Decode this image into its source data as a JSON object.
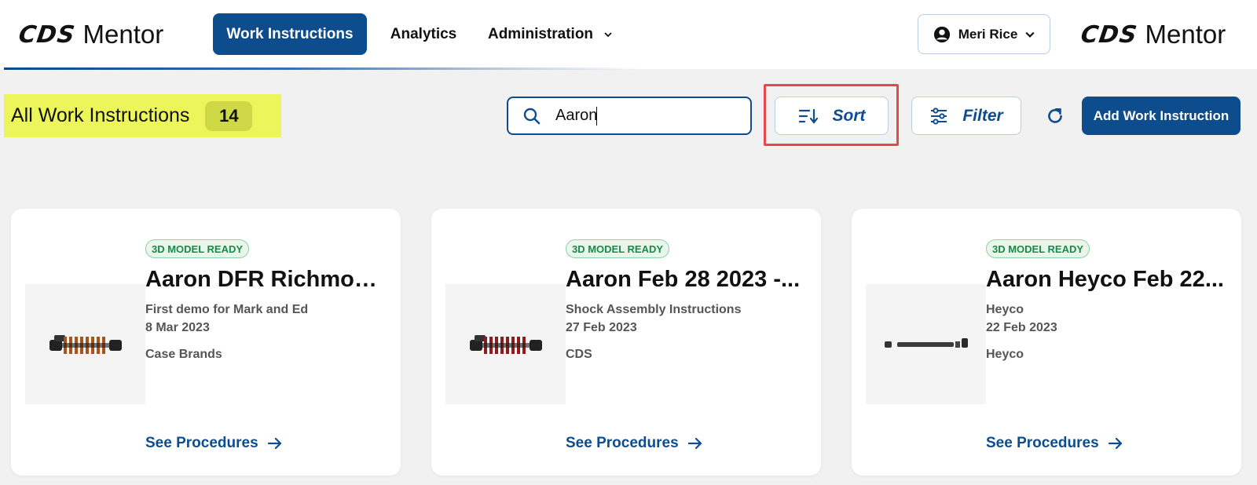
{
  "header": {
    "logo": {
      "mark": "CDS",
      "word": "Mentor"
    },
    "nav": {
      "work_instructions": "Work Instructions",
      "analytics": "Analytics",
      "administration": "Administration"
    },
    "user": {
      "name": "Meri Rice",
      "icon": "account-circle-icon"
    },
    "brand_logo": {
      "mark": "CDS",
      "word": "Mentor"
    }
  },
  "toolbar": {
    "title": "All Work Instructions",
    "count": "14",
    "search_value": "Aaron",
    "sort_label": "Sort",
    "filter_label": "Filter",
    "add_label": "Add Work Instruction"
  },
  "cards": [
    {
      "badge": "3D MODEL READY",
      "name": "Aaron DFR Richmond ...",
      "description": "First demo for Mark and Ed",
      "date": "8 Mar 2023",
      "organization": "Case Brands",
      "link": "See Procedures",
      "thumbnail": "coil-shock-orange"
    },
    {
      "badge": "3D MODEL READY",
      "name": "Aaron Feb 28 2023 -...",
      "description": "Shock Assembly Instructions",
      "date": "27 Feb 2023",
      "organization": "CDS",
      "link": "See Procedures",
      "thumbnail": "coil-shock-red"
    },
    {
      "badge": "3D MODEL READY",
      "name": "Aaron Heyco Feb 22...",
      "description": "Heyco",
      "date": "22 Feb 2023",
      "organization": "Heyco",
      "link": "See Procedures",
      "thumbnail": "rod-assembly"
    }
  ],
  "colors": {
    "primary": "#0d4c8d",
    "highlight_yellow": "#ecf55a",
    "annotation_red": "#e5494d",
    "badge_green": "#1a8a46"
  }
}
